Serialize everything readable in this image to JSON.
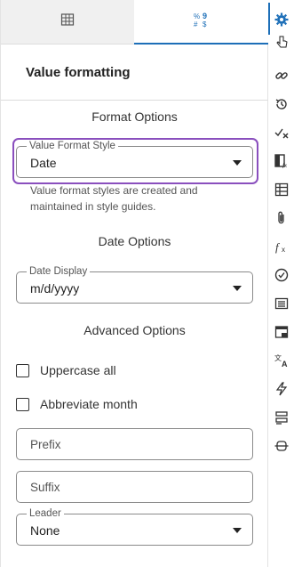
{
  "panel": {
    "tabs": [
      {
        "name": "grid",
        "icon": "table-grid-icon"
      },
      {
        "name": "format",
        "icon": "number-format-icon"
      }
    ],
    "title": "Value formatting",
    "format_options": {
      "heading": "Format Options",
      "value_format_style": {
        "label": "Value Format Style",
        "value": "Date"
      },
      "helper_text": "Value format styles are created and maintained in style guides."
    },
    "date_options": {
      "heading": "Date Options",
      "date_display": {
        "label": "Date Display",
        "value": "m/d/yyyy"
      }
    },
    "advanced_options": {
      "heading": "Advanced Options",
      "uppercase_all": {
        "label": "Uppercase all",
        "checked": false
      },
      "abbreviate_month": {
        "label": "Abbreviate month",
        "checked": false
      },
      "prefix": {
        "placeholder": "Prefix"
      },
      "suffix": {
        "placeholder": "Suffix"
      },
      "leader": {
        "label": "Leader",
        "value": "None"
      }
    }
  },
  "rail": {
    "accent_color": "#1d6fb8",
    "icons": [
      "gear-icon",
      "link-icon",
      "history-icon",
      "check-x-icon",
      "conditional-format-icon",
      "table-icon",
      "attachment-icon",
      "fx-icon",
      "check-circle-icon",
      "list-icon",
      "comment-icon",
      "translate-icon",
      "lightning-icon",
      "layout-icon",
      "divider-icon"
    ]
  },
  "colors": {
    "focus_ring": "#8a4fbe",
    "tab_active": "#1d6fb8"
  }
}
